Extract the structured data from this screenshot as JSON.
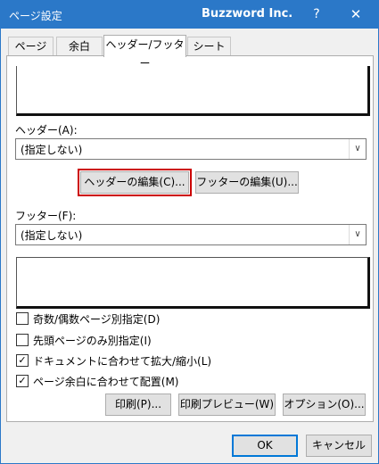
{
  "window": {
    "title": "ページ設定",
    "app_name": "Buzzword Inc.",
    "help_label": "?",
    "close_label": "✕"
  },
  "tabs": [
    {
      "label": "ページ",
      "active": false
    },
    {
      "label": "余白",
      "active": false
    },
    {
      "label": "ヘッダー/フッター",
      "active": true
    },
    {
      "label": "シート",
      "active": false
    }
  ],
  "header": {
    "label": "ヘッダー(A):",
    "value": "(指定しない)",
    "edit_button": "ヘッダーの編集(C)..."
  },
  "footer": {
    "label": "フッター(F):",
    "value": "(指定しない)",
    "edit_button": "フッターの編集(U)..."
  },
  "checkboxes": [
    {
      "label": "奇数/偶数ページ別指定(D)",
      "checked": false
    },
    {
      "label": "先頭ページのみ別指定(I)",
      "checked": false
    },
    {
      "label": "ドキュメントに合わせて拡大/縮小(L)",
      "checked": true
    },
    {
      "label": "ページ余白に合わせて配置(M)",
      "checked": true
    }
  ],
  "buttons": {
    "print": "印刷(P)...",
    "print_preview": "印刷プレビュー(W)",
    "options": "オプション(O)...",
    "ok": "OK",
    "cancel": "キャンセル"
  },
  "icons": {
    "dropdown": "chevron-down-icon",
    "checkmark": "check-icon"
  },
  "colors": {
    "titlebar": "#2b78c8",
    "highlight": "#cc0000"
  }
}
